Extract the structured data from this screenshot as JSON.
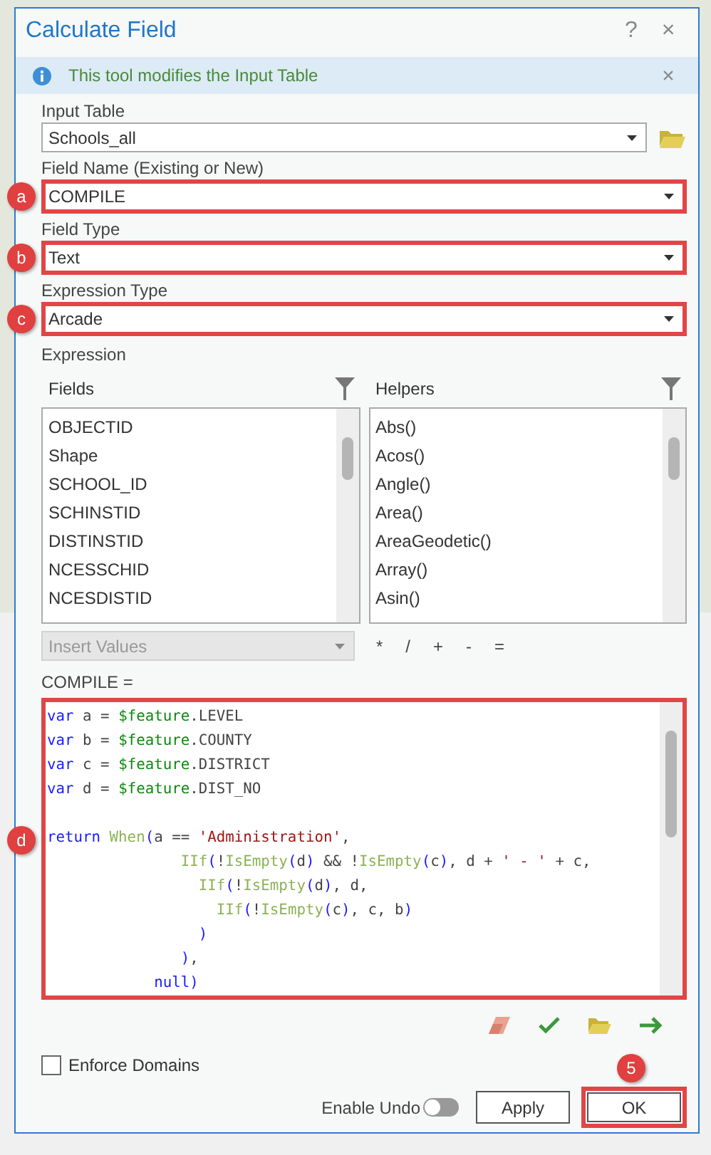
{
  "dialog": {
    "title": "Calculate Field",
    "help": "?",
    "close": "×"
  },
  "info_bar": {
    "message": "This tool modifies the Input Table",
    "close": "×"
  },
  "params": [
    {
      "label": "Input Table",
      "value": "Schools_all",
      "highlighted": false,
      "browse": true
    },
    {
      "label": "Field Name (Existing or New)",
      "value": "COMPILE",
      "highlighted": true,
      "marker": "a"
    },
    {
      "label": "Field Type",
      "value": "Text",
      "highlighted": true,
      "marker": "b"
    },
    {
      "label": "Expression Type",
      "value": "Arcade",
      "highlighted": true,
      "marker": "c"
    }
  ],
  "expression": {
    "label": "Expression",
    "fields": {
      "title": "Fields",
      "items": [
        "OBJECTID",
        "Shape",
        "SCHOOL_ID",
        "SCHINSTID",
        "DISTINSTID",
        "NCESSCHID",
        "NCESDISTID"
      ]
    },
    "helpers": {
      "title": "Helpers",
      "items": [
        "Abs()",
        "Acos()",
        "Angle()",
        "Area()",
        "AreaGeodetic()",
        "Array()",
        "Asin()"
      ]
    },
    "insert_values": {
      "value": "Insert Values",
      "disabled": true
    },
    "operators": [
      "*",
      "/",
      "+",
      "-",
      "="
    ],
    "target_label": "COMPILE =",
    "code": {
      "highlighted": true,
      "marker": "d",
      "lines": [
        {
          "tokens": [
            {
              "kind": "keyword",
              "text": "var"
            },
            {
              "kind": "plain",
              "text": " a = "
            },
            {
              "kind": "feature",
              "text": "$feature"
            },
            {
              "kind": "plain",
              "text": ".LEVEL"
            }
          ]
        },
        {
          "tokens": [
            {
              "kind": "keyword",
              "text": "var"
            },
            {
              "kind": "plain",
              "text": " b = "
            },
            {
              "kind": "feature",
              "text": "$feature"
            },
            {
              "kind": "plain",
              "text": ".COUNTY"
            }
          ]
        },
        {
          "tokens": [
            {
              "kind": "keyword",
              "text": "var"
            },
            {
              "kind": "plain",
              "text": " c = "
            },
            {
              "kind": "feature",
              "text": "$feature"
            },
            {
              "kind": "plain",
              "text": ".DISTRICT"
            }
          ]
        },
        {
          "tokens": [
            {
              "kind": "keyword",
              "text": "var"
            },
            {
              "kind": "plain",
              "text": " d = "
            },
            {
              "kind": "feature",
              "text": "$feature"
            },
            {
              "kind": "plain",
              "text": ".DIST_NO"
            }
          ]
        },
        {
          "blank_before": true,
          "tokens": [
            {
              "kind": "keyword",
              "text": "return "
            },
            {
              "kind": "func",
              "text": "When"
            },
            {
              "kind": "paren",
              "text": "("
            },
            {
              "kind": "plain",
              "text": "a == "
            },
            {
              "kind": "string",
              "text": "'Administration'"
            },
            {
              "kind": "plain",
              "text": ","
            }
          ]
        },
        {
          "tokens": [
            {
              "kind": "func",
              "text": "               IIf"
            },
            {
              "kind": "paren",
              "text": "("
            },
            {
              "kind": "plain",
              "text": "!"
            },
            {
              "kind": "func",
              "text": "IsEmpty"
            },
            {
              "kind": "paren",
              "text": "("
            },
            {
              "kind": "plain",
              "text": "d"
            },
            {
              "kind": "paren",
              "text": ")"
            },
            {
              "kind": "plain",
              "text": " && !"
            },
            {
              "kind": "func",
              "text": "IsEmpty"
            },
            {
              "kind": "paren",
              "text": "("
            },
            {
              "kind": "plain",
              "text": "c"
            },
            {
              "kind": "paren",
              "text": ")"
            },
            {
              "kind": "plain",
              "text": ", d + "
            },
            {
              "kind": "string",
              "text": "' - '"
            },
            {
              "kind": "plain",
              "text": " + c,"
            }
          ]
        },
        {
          "tokens": [
            {
              "kind": "func",
              "text": "                 IIf"
            },
            {
              "kind": "paren",
              "text": "("
            },
            {
              "kind": "plain",
              "text": "!"
            },
            {
              "kind": "func",
              "text": "IsEmpty"
            },
            {
              "kind": "paren",
              "text": "("
            },
            {
              "kind": "plain",
              "text": "d"
            },
            {
              "kind": "paren",
              "text": ")"
            },
            {
              "kind": "plain",
              "text": ", d,"
            }
          ]
        },
        {
          "tokens": [
            {
              "kind": "func",
              "text": "                   IIf"
            },
            {
              "kind": "paren",
              "text": "("
            },
            {
              "kind": "plain",
              "text": "!"
            },
            {
              "kind": "func",
              "text": "IsEmpty"
            },
            {
              "kind": "paren",
              "text": "("
            },
            {
              "kind": "plain",
              "text": "c"
            },
            {
              "kind": "paren",
              "text": ")"
            },
            {
              "kind": "plain",
              "text": ", c, b"
            },
            {
              "kind": "paren",
              "text": ")"
            }
          ]
        },
        {
          "tokens": [
            {
              "kind": "paren",
              "text": "                 )"
            }
          ]
        },
        {
          "tokens": [
            {
              "kind": "paren",
              "text": "               )"
            },
            {
              "kind": "plain",
              "text": ","
            }
          ]
        },
        {
          "tokens": [
            {
              "kind": "keyword",
              "text": "            null"
            },
            {
              "kind": "paren",
              "text": ")"
            }
          ]
        }
      ]
    }
  },
  "enforce_domains": {
    "label": "Enforce Domains",
    "checked": false
  },
  "enable_undo": {
    "label": "Enable Undo",
    "on": false
  },
  "buttons": [
    {
      "label": "Apply",
      "highlighted": false
    },
    {
      "label": "OK",
      "highlighted": true,
      "marker": "5"
    }
  ]
}
